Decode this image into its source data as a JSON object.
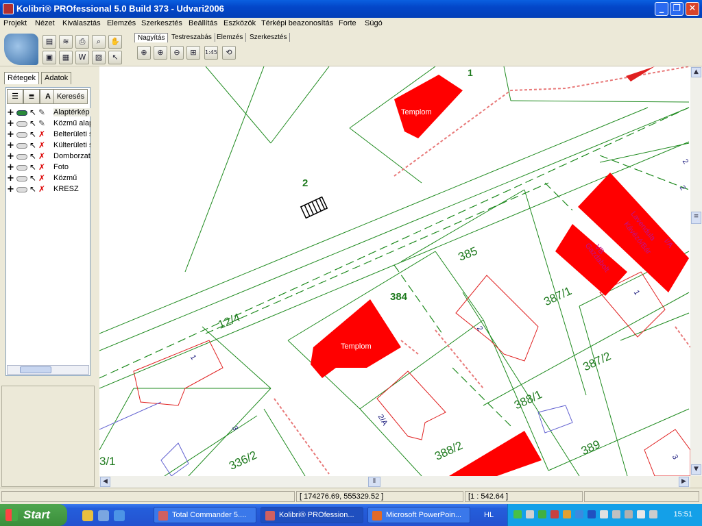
{
  "window": {
    "title": "Kolibri® PROfessional 5.0 Build 373 - Udvari2006",
    "minimize": "_",
    "maximize": "❐",
    "close": "✕"
  },
  "menu": [
    "Projekt",
    "Nézet",
    "Kiválasztás",
    "Elemzés",
    "Szerkesztés",
    "Beállítás",
    "Eszközök",
    "Térképi beazonosítás",
    "Forte",
    "Súgó"
  ],
  "toolbar": {
    "tabs": [
      "Nagyítás",
      "Testreszabás",
      "Elemzés",
      "Szerkesztés"
    ],
    "active_tab": "Nagyítás",
    "zoom_scale_label": "1:45"
  },
  "panel": {
    "tabs": [
      "Rétegek",
      "Adatok"
    ],
    "search_label": "Keresés",
    "layers": [
      {
        "name": "Alaptérkép",
        "visible": true,
        "editable": true
      },
      {
        "name": "Közmű alap",
        "visible": false,
        "editable": true
      },
      {
        "name": "Belterületi s",
        "visible": false,
        "editable": false
      },
      {
        "name": "Külterületi s",
        "visible": false,
        "editable": false
      },
      {
        "name": "Domborzat",
        "visible": false,
        "editable": false
      },
      {
        "name": "Foto",
        "visible": false,
        "editable": false
      },
      {
        "name": "Közmű",
        "visible": false,
        "editable": false
      },
      {
        "name": "KRESZ",
        "visible": false,
        "editable": false
      }
    ]
  },
  "map": {
    "labels": {
      "n1": "1",
      "n2": "2",
      "n385": "385",
      "n384": "384",
      "n12_4": "12/4",
      "n387_1": "387/1",
      "n387_2": "387/2",
      "n388_1": "388/1",
      "n388_2": "388/2",
      "n389": "389",
      "n336_2": "336/2",
      "n3_1": "3/1",
      "n2a": "2/A",
      "n3": "3",
      "h1": "1",
      "h2": "2",
      "h1b": "1",
      "h2r": "2",
      "h3": "3",
      "h2c": "2",
      "h1d": "1",
      "templom1": "Templom",
      "templom2": "Templom",
      "lavendula": "Lavendula",
      "kavezo": "Kávézó/Bár",
      "vb": "VB",
      "gazdabolt": "Gazdabolt",
      "ia": "I/A"
    }
  },
  "status": {
    "coordinates": "[ 174276.69, 555329.52 ]",
    "scale": "[1 : 542.64 ]"
  },
  "taskbar": {
    "start": "Start",
    "buttons": [
      "Total Commander 5....",
      "Kolibri® PROfession...",
      "Microsoft PowerPoin..."
    ],
    "active": 1,
    "language": "HL",
    "clock": "15:51"
  },
  "colors": {
    "parcel": "#1e8a1e",
    "building": "#ff0000",
    "title_bar": "#0346c8",
    "taskbar": "#245edb"
  }
}
